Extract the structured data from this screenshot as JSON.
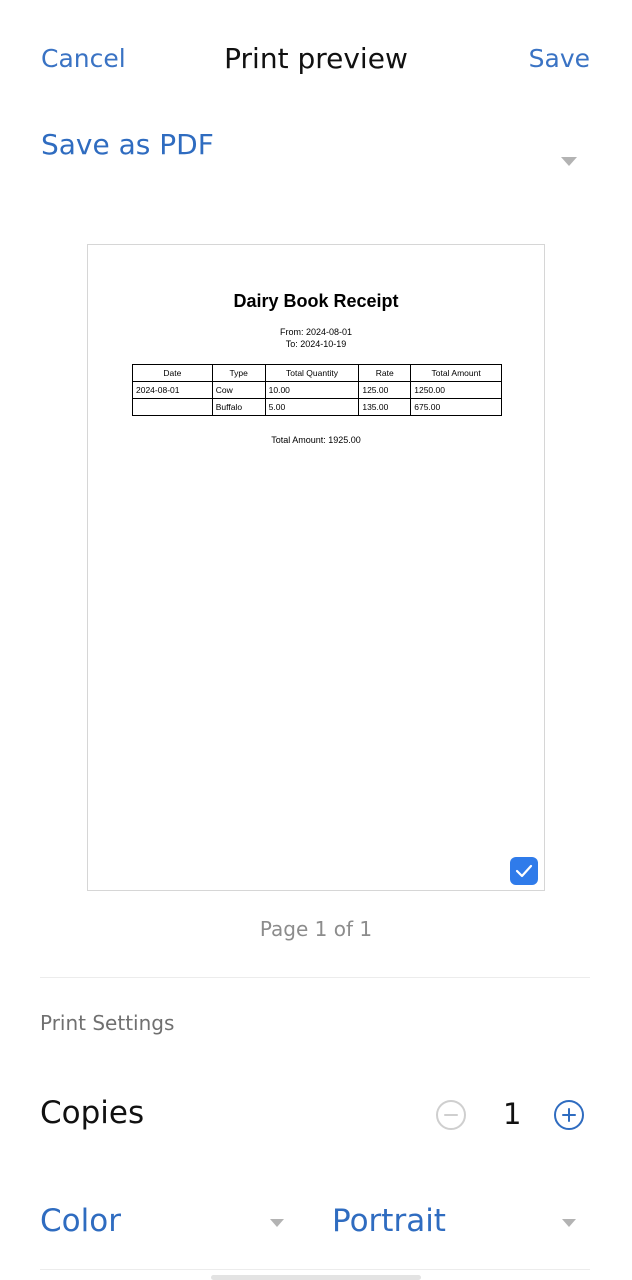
{
  "header": {
    "cancel_label": "Cancel",
    "title": "Print preview",
    "save_label": "Save"
  },
  "printer": {
    "selected": "Save as PDF"
  },
  "receipt": {
    "title": "Dairy Book Receipt",
    "from": "From: 2024-08-01",
    "to": "To: 2024-10-19",
    "columns": [
      "Date",
      "Type",
      "Total Quantity",
      "Rate",
      "Total Amount"
    ],
    "rows": [
      [
        "2024-08-01",
        "Cow",
        "10.00",
        "125.00",
        "1250.00"
      ],
      [
        "",
        "Buffalo",
        "5.00",
        "135.00",
        "675.00"
      ]
    ],
    "total": "Total Amount: 1925.00"
  },
  "page_indicator": "Page 1 of 1",
  "settings": {
    "header": "Print Settings",
    "copies_label": "Copies",
    "copies_value": "1",
    "color": "Color",
    "orientation": "Portrait"
  },
  "colors": {
    "accent": "#2f6cc0",
    "check_bg": "#2f7bea"
  }
}
